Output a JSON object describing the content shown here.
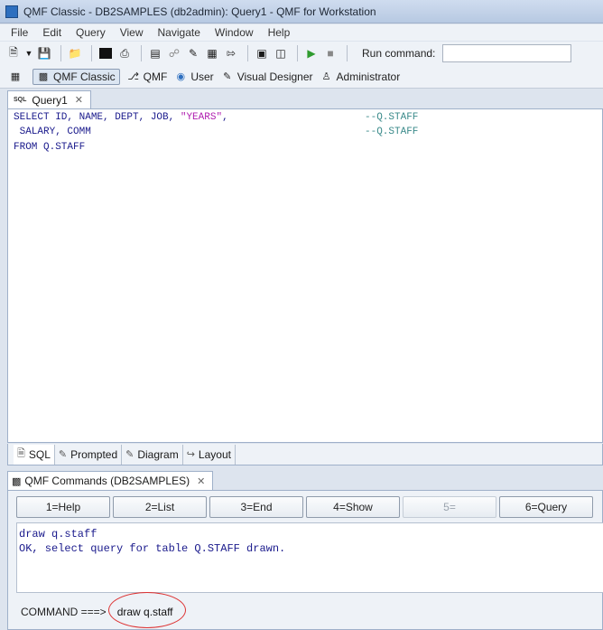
{
  "window": {
    "title": "QMF Classic - DB2SAMPLES (db2admin): Query1 - QMF for Workstation"
  },
  "menu": [
    "File",
    "Edit",
    "Query",
    "View",
    "Navigate",
    "Window",
    "Help"
  ],
  "toolbar": {
    "run_command_label": "Run command:",
    "run_command_value": "",
    "icons": [
      "new-icon",
      "dropdown-icon",
      "save-icon",
      "open-folder-icon",
      "console-icon",
      "print-icon",
      "properties-icon",
      "link-icon",
      "wizard-icon",
      "table-icon",
      "export-icon",
      "window-icon",
      "panel-icon",
      "run-icon",
      "stop-icon"
    ]
  },
  "perspectives": [
    {
      "label": "QMF Classic",
      "active": true,
      "icon": "qmf-classic-icon"
    },
    {
      "label": "QMF",
      "active": false,
      "icon": "qmf-icon"
    },
    {
      "label": "User",
      "active": false,
      "icon": "user-icon"
    },
    {
      "label": "Visual Designer",
      "active": false,
      "icon": "visual-designer-icon"
    },
    {
      "label": "Administrator",
      "active": false,
      "icon": "administrator-icon"
    }
  ],
  "editor": {
    "tab_label": "Query1",
    "tab_icon_text": "SQL",
    "code": {
      "line1_prefix": "SELECT ID, NAME, DEPT, JOB, ",
      "line1_string": "\"YEARS\"",
      "line1_suffix": ",",
      "line1_comment": "--Q.STAFF",
      "line2": " SALARY, COMM",
      "line2_comment": "--Q.STAFF",
      "line3": "FROM Q.STAFF"
    }
  },
  "editor_subtabs": [
    {
      "label": "SQL",
      "active": true
    },
    {
      "label": "Prompted",
      "active": false
    },
    {
      "label": "Diagram",
      "active": false
    },
    {
      "label": "Layout",
      "active": false
    }
  ],
  "commands_view": {
    "tab_label": "QMF Commands (DB2SAMPLES)",
    "function_keys": [
      "1=Help",
      "2=List",
      "3=End",
      "4=Show",
      "5=",
      "6=Query"
    ],
    "output_lines": [
      "draw q.staff",
      "OK, select query for table Q.STAFF drawn."
    ],
    "command_label": "COMMAND ===>",
    "command_value": "draw q.staff"
  }
}
